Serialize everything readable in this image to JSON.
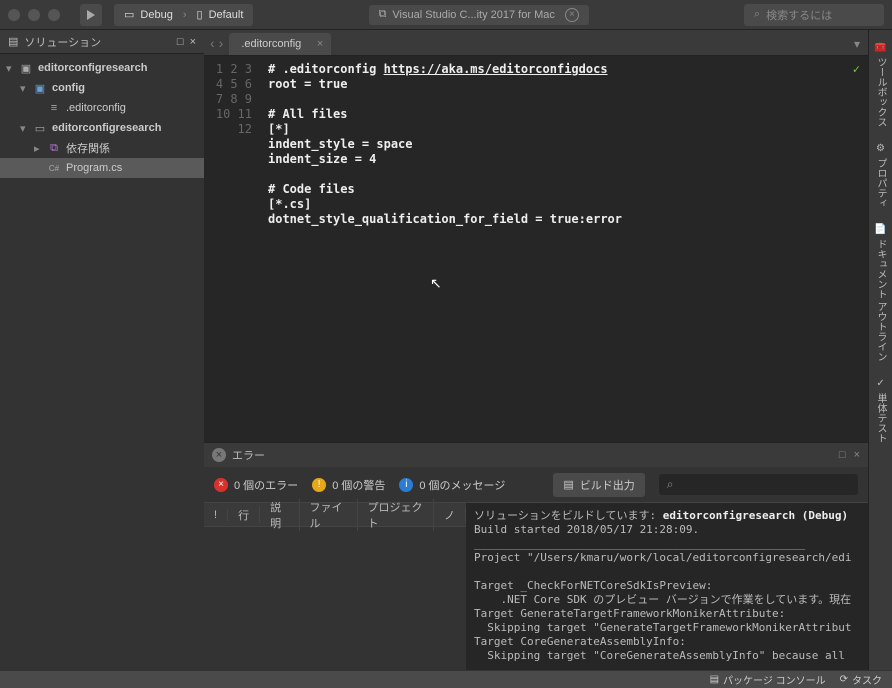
{
  "titlebar": {
    "config": "Debug",
    "target": "Default",
    "app_title": "Visual Studio C...ity 2017 for Mac",
    "search_placeholder": "検索するには"
  },
  "solution_panel": {
    "title": "ソリューション",
    "pin": "□",
    "close": "×",
    "tree": [
      {
        "depth": 0,
        "arrow": "▾",
        "icon": "solution",
        "label": "editorconfigresearch"
      },
      {
        "depth": 1,
        "arrow": "▾",
        "icon": "folder",
        "label": "config"
      },
      {
        "depth": 2,
        "arrow": "",
        "icon": "file",
        "label": ".editorconfig"
      },
      {
        "depth": 1,
        "arrow": "▾",
        "icon": "project",
        "label": "editorconfigresearch"
      },
      {
        "depth": 2,
        "arrow": "▸",
        "icon": "package",
        "label": "依存関係"
      },
      {
        "depth": 2,
        "arrow": "",
        "icon": "csharp",
        "label": "Program.cs",
        "selected": true
      }
    ]
  },
  "editor": {
    "tab_name": ".editorconfig",
    "lines": [
      "# .editorconfig https://aka.ms/editorconfigdocs",
      "root = true",
      "",
      "# All files",
      "[*]",
      "indent_style = space",
      "indent_size = 4",
      "",
      "# Code files",
      "[*.cs]",
      "dotnet_style_qualification_for_field = true:error",
      ""
    ],
    "line_numbers": [
      "1",
      "2",
      "3",
      "4",
      "5",
      "6",
      "7",
      "8",
      "9",
      "10",
      "11",
      "12"
    ]
  },
  "errors_panel": {
    "title": "エラー",
    "errors_count": "0 個のエラー",
    "warnings_count": "0 個の警告",
    "messages_count": "0 個のメッセージ",
    "build_output": "ビルド出力",
    "columns": [
      "!",
      "行",
      "説明",
      "ファイル",
      "プロジェクト",
      "ノ"
    ],
    "output_prefix": "ソリューションをビルドしています: ",
    "output_solution": "editorconfigresearch (Debug)",
    "output_lines": [
      "Build started 2018/05/17 21:28:09.",
      "__________________________________________________",
      "Project \"/Users/kmaru/work/local/editorconfigresearch/edi",
      "",
      "Target _CheckForNETCoreSdkIsPreview:",
      "    .NET Core SDK のプレビュー バージョンで作業をしています。現在",
      "Target GenerateTargetFrameworkMonikerAttribute:",
      "  Skipping target \"GenerateTargetFrameworkMonikerAttribut",
      "Target CoreGenerateAssemblyInfo:",
      "  Skipping target \"CoreGenerateAssemblyInfo\" because all"
    ]
  },
  "right_rail": {
    "tabs": [
      "ツールボックス",
      "プロパティ",
      "ドキュメント アウトライン",
      "単体テスト"
    ]
  },
  "statusbar": {
    "package_console": "パッケージ コンソール",
    "tasks": "タスク"
  }
}
